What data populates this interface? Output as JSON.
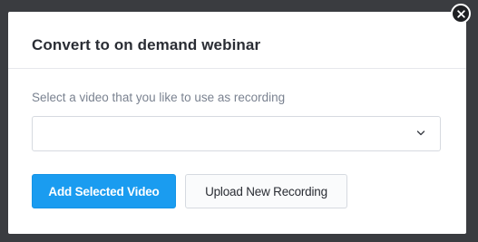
{
  "modal": {
    "title": "Convert to on demand webinar",
    "field_label": "Select a video that you like to use as recording",
    "select": {
      "selected_value": "",
      "icon": "chevron-down-icon"
    },
    "primary_button_label": "Add Selected Video",
    "secondary_button_label": "Upload New Recording",
    "close_icon": "close-icon"
  },
  "colors": {
    "backdrop": "#3a3c40",
    "primary": "#1a9cf0",
    "title_text": "#2a2d34",
    "label_text": "#7a8290"
  }
}
